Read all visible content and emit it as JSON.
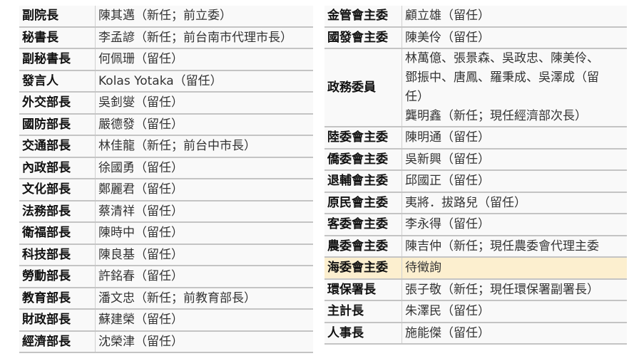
{
  "left_table": [
    {
      "title": "副院長",
      "person": "陳其邁（新任；前立委）"
    },
    {
      "title": "秘書長",
      "person": "李孟諺（新任；前台南市代理市長）"
    },
    {
      "title": "副秘書長",
      "person": "何佩珊（留任）"
    },
    {
      "title": "發言人",
      "person": "Kolas Yotaka（留任）"
    },
    {
      "title": "外交部長",
      "person": "吳釗燮（留任）"
    },
    {
      "title": "國防部長",
      "person": "嚴德發（留任）"
    },
    {
      "title": "交通部長",
      "person": "林佳龍（新任；前台中市長）"
    },
    {
      "title": "內政部長",
      "person": "徐國勇（留任）"
    },
    {
      "title": "文化部長",
      "person": "鄭麗君（留任）"
    },
    {
      "title": "法務部長",
      "person": "蔡清祥（留任）"
    },
    {
      "title": "衛福部長",
      "person": "陳時中（留任）"
    },
    {
      "title": "科技部長",
      "person": "陳良基（留任）"
    },
    {
      "title": "勞動部長",
      "person": "許銘春（留任）"
    },
    {
      "title": "教育部長",
      "person": "潘文忠（新任；前教育部長）"
    },
    {
      "title": "財政部長",
      "person": "蘇建榮（留任）"
    },
    {
      "title": "經濟部長",
      "person": "沈榮津（留任）"
    }
  ],
  "right_table": {
    "rows_top": [
      {
        "title": "金管會主委",
        "person": "顧立雄（留任）"
      },
      {
        "title": "國發會主委",
        "person": "陳美伶（留任）"
      }
    ],
    "commissioners": {
      "title": "政務委員",
      "line1": "林萬億、張景森、吳政忠、陳美伶、",
      "line2": "鄧振中、唐鳳、羅秉成、吳澤成（留",
      "line3": "任）",
      "line4": "龔明鑫（新任；現任經濟部次長）"
    },
    "rows_bottom": [
      {
        "title": "陸委會主委",
        "person": "陳明通（留任）"
      },
      {
        "title": "僑委會主委",
        "person": "吳新興（留任）"
      },
      {
        "title": "退輔會主委",
        "person": "邱國正（留任）"
      },
      {
        "title": "原民會主委",
        "person": "夷將．拔路兒（留任）"
      },
      {
        "title": "客委會主委",
        "person": "李永得（留任）"
      },
      {
        "title": "農委會主委",
        "person": "陳吉仲（新任；現任農委會代理主委"
      },
      {
        "title": "海委會主委",
        "person": "待徵詢"
      },
      {
        "title": "環保署長",
        "person": "張子敬（新任；現任環保署副署長）"
      },
      {
        "title": "主計長",
        "person": "朱澤民（留任）"
      },
      {
        "title": "人事長",
        "person": "施能傑（留任）"
      }
    ],
    "highlight_color": "#fcefcf"
  }
}
